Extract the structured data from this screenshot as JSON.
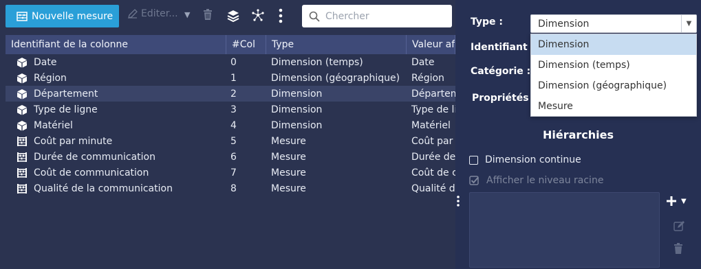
{
  "toolbar": {
    "new_measure_label": "Nouvelle mesure",
    "edit_label": "Editer...",
    "search_placeholder": "Chercher"
  },
  "table": {
    "columns": [
      "Identifiant de la colonne",
      "#Col",
      "Type",
      "Valeur affichée"
    ],
    "rows": [
      {
        "icon": "cube-icon",
        "name": "Date",
        "col": "0",
        "type": "Dimension (temps)",
        "value": "Date"
      },
      {
        "icon": "cube-icon",
        "name": "Région",
        "col": "1",
        "type": "Dimension (géographique)",
        "value": "Région"
      },
      {
        "icon": "cube-icon",
        "name": "Département",
        "col": "2",
        "type": "Dimension",
        "value": "Département"
      },
      {
        "icon": "cube-icon",
        "name": "Type de ligne",
        "col": "3",
        "type": "Dimension",
        "value": "Type de ligne"
      },
      {
        "icon": "cube-icon",
        "name": "Matériel",
        "col": "4",
        "type": "Dimension",
        "value": "Matériel"
      },
      {
        "icon": "abacus-icon",
        "name": "Coût par minute",
        "col": "5",
        "type": "Mesure",
        "value": "Coût par minute"
      },
      {
        "icon": "abacus-icon",
        "name": "Durée de communication",
        "col": "6",
        "type": "Mesure",
        "value": "Durée de communication"
      },
      {
        "icon": "abacus-icon",
        "name": "Coût de communication",
        "col": "7",
        "type": "Mesure",
        "value": "Coût de communication"
      },
      {
        "icon": "abacus-icon",
        "name": "Qualité de la communication",
        "col": "8",
        "type": "Mesure",
        "value": "Qualité de la communication"
      }
    ],
    "selected_row": 2
  },
  "panel": {
    "type_label": "Type :",
    "type_value": "Dimension",
    "id_label": "Identifiant :",
    "category_label": "Catégorie :",
    "properties_label": "Propriétés :",
    "type_options": [
      "Dimension",
      "Dimension (temps)",
      "Dimension (géographique)",
      "Mesure"
    ],
    "hierarchies_title": "Hiérarchies",
    "continuous_label": "Dimension continue",
    "root_label": "Afficher le niveau racine"
  },
  "colors": {
    "background": "#2b3350",
    "panel": "#263053",
    "header": "#3e4a78",
    "primary": "#2a9fd8",
    "selected_row": "#3a4468",
    "option_active": "#c7dcf1"
  }
}
